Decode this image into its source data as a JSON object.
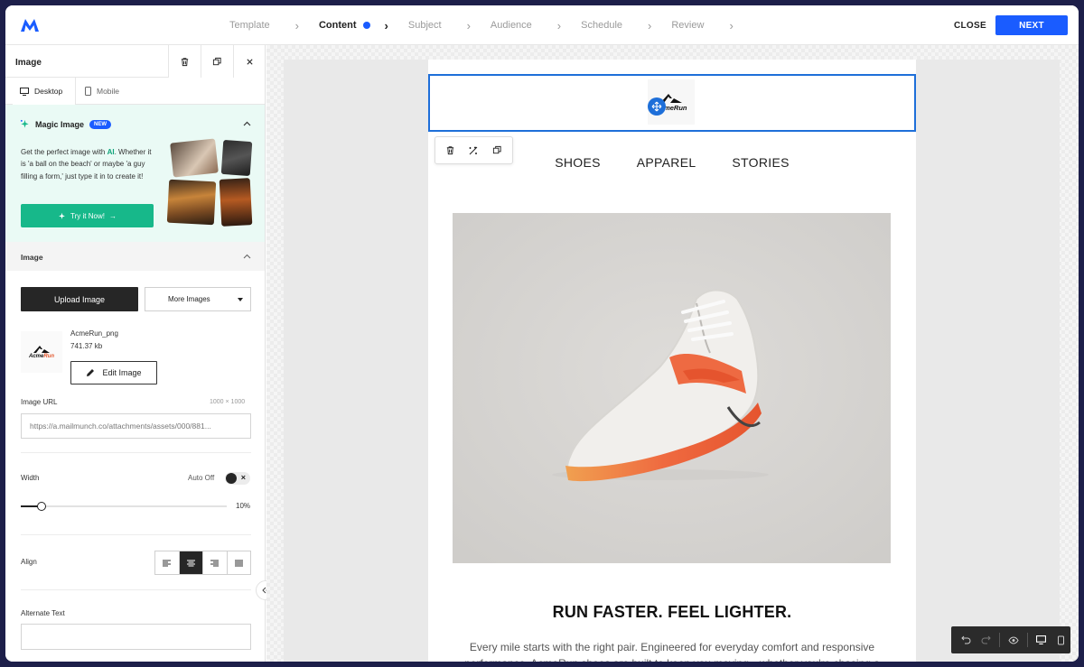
{
  "header": {
    "steps": [
      {
        "label": "Template",
        "active": false
      },
      {
        "label": "Content",
        "active": true
      },
      {
        "label": "Subject",
        "active": false
      },
      {
        "label": "Audience",
        "active": false
      },
      {
        "label": "Schedule",
        "active": false
      },
      {
        "label": "Review",
        "active": false
      }
    ],
    "close_label": "CLOSE",
    "next_label": "NEXT"
  },
  "panel": {
    "title": "Image",
    "tabs": {
      "desktop": "Desktop",
      "mobile": "Mobile"
    },
    "magic": {
      "title": "Magic Image",
      "badge": "NEW",
      "desc_before": "Get the perfect image with ",
      "desc_ai": "AI",
      "desc_after": ". Whether it is 'a ball on the beach' or maybe 'a guy filling a form,' just type it in to create it!",
      "button": "Try it Now!"
    },
    "image_section": {
      "title": "Image",
      "upload_label": "Upload Image",
      "more_label": "More Images",
      "file_name": "AcmeRun_png",
      "file_size": "741.37 kb",
      "edit_label": "Edit Image",
      "url_label": "Image URL",
      "dimensions": "1000 × 1000",
      "url_value": "https://a.mailmunch.co/attachments/assets/000/881...",
      "width_label": "Width",
      "auto_label": "Auto Off",
      "width_value": "10%",
      "width_percent": 10,
      "align_label": "Align",
      "alt_label": "Alternate Text",
      "alt_value": ""
    }
  },
  "email": {
    "logo_text": "AcmeRun",
    "nav": [
      "SHOES",
      "APPAREL",
      "STORIES"
    ],
    "headline": "RUN FASTER. FEEL LIGHTER.",
    "body": "Every mile starts with the right pair. Engineered for everyday comfort and responsive performance, AcmeRun shoes are built to keep you moving—whether you're chasing a"
  },
  "colors": {
    "accent": "#1a5cff",
    "magic_button": "#17b88a",
    "selection": "#1e6fd9"
  }
}
